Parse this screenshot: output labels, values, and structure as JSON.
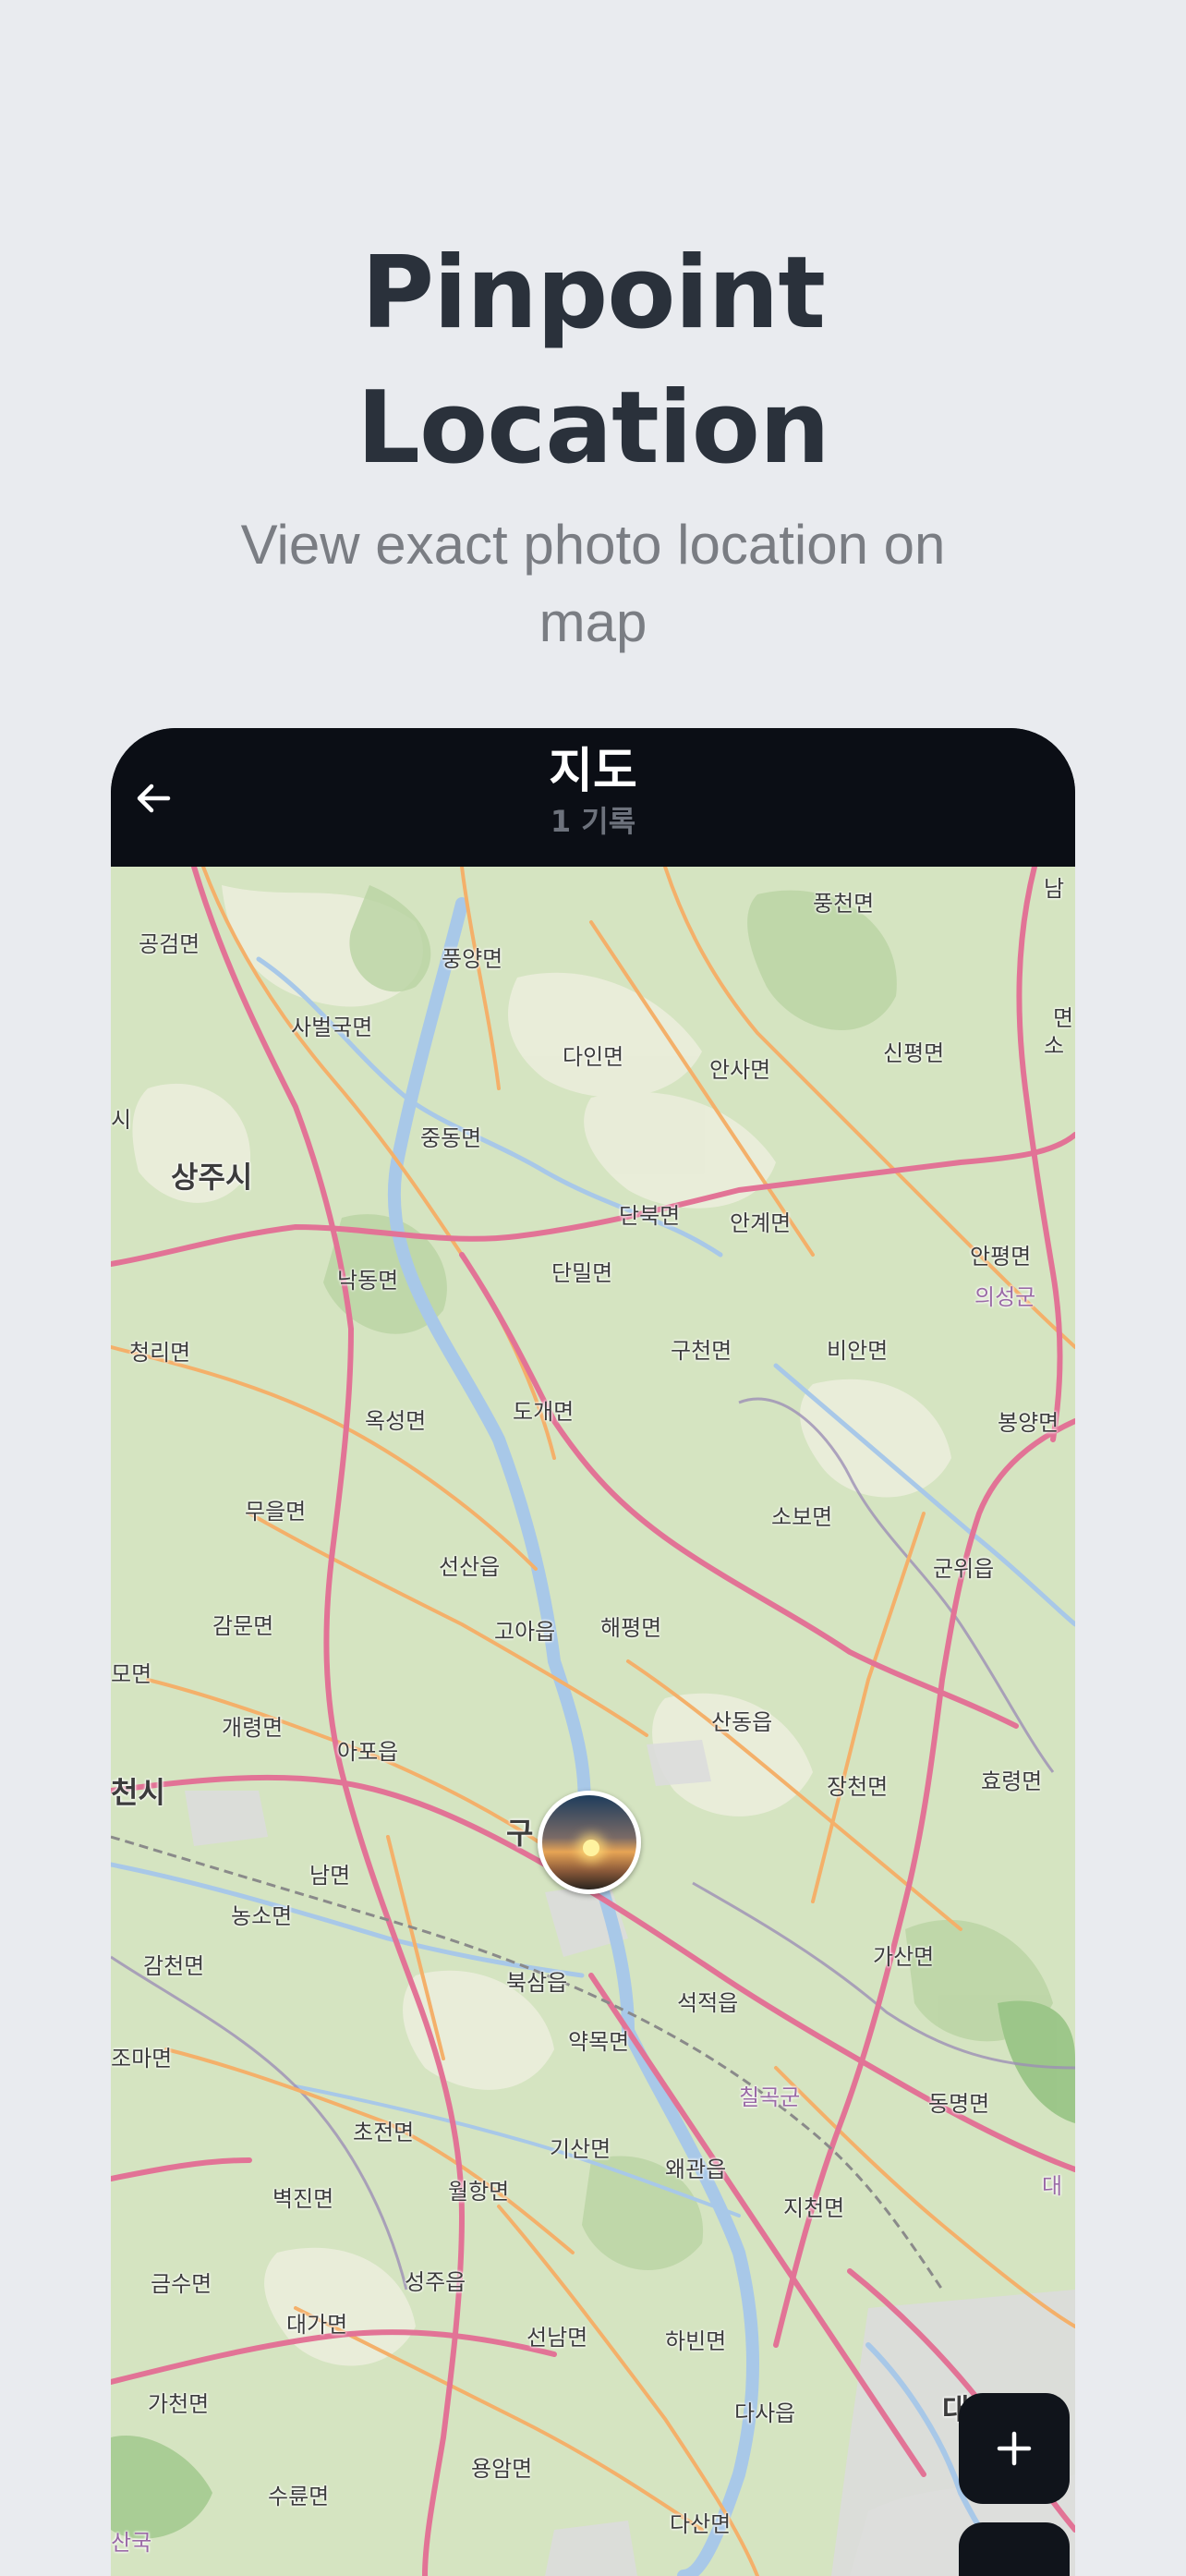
{
  "headline": [
    "Pinpoint",
    "Location"
  ],
  "subtitle": "View exact photo location on map",
  "app": {
    "title": "지도",
    "subtitle": "1 기록"
  },
  "map": {
    "places": [
      {
        "name": "공검면",
        "kind": "normal"
      },
      {
        "name": "풍양면",
        "kind": "normal"
      },
      {
        "name": "풍천면",
        "kind": "normal"
      },
      {
        "name": "사벌국면",
        "kind": "normal"
      },
      {
        "name": "다인면",
        "kind": "normal"
      },
      {
        "name": "안사면",
        "kind": "normal"
      },
      {
        "name": "신평면",
        "kind": "normal"
      },
      {
        "name": "중동면",
        "kind": "normal"
      },
      {
        "name": "상주시",
        "kind": "big"
      },
      {
        "name": "단북면",
        "kind": "normal"
      },
      {
        "name": "안계면",
        "kind": "normal"
      },
      {
        "name": "안평면",
        "kind": "normal"
      },
      {
        "name": "의성군",
        "kind": "purple"
      },
      {
        "name": "낙동면",
        "kind": "normal"
      },
      {
        "name": "단밀면",
        "kind": "normal"
      },
      {
        "name": "청리면",
        "kind": "normal"
      },
      {
        "name": "구천면",
        "kind": "normal"
      },
      {
        "name": "비안면",
        "kind": "normal"
      },
      {
        "name": "옥성면",
        "kind": "normal"
      },
      {
        "name": "도개면",
        "kind": "normal"
      },
      {
        "name": "봉양면",
        "kind": "normal"
      },
      {
        "name": "무을면",
        "kind": "normal"
      },
      {
        "name": "소보면",
        "kind": "normal"
      },
      {
        "name": "선산읍",
        "kind": "normal"
      },
      {
        "name": "군위읍",
        "kind": "normal"
      },
      {
        "name": "감문면",
        "kind": "normal"
      },
      {
        "name": "고아읍",
        "kind": "normal"
      },
      {
        "name": "해평면",
        "kind": "normal"
      },
      {
        "name": "모면",
        "kind": "normal"
      },
      {
        "name": "개령면",
        "kind": "normal"
      },
      {
        "name": "산동읍",
        "kind": "normal"
      },
      {
        "name": "아포읍",
        "kind": "normal"
      },
      {
        "name": "천시",
        "kind": "big"
      },
      {
        "name": "장천면",
        "kind": "normal"
      },
      {
        "name": "효령면",
        "kind": "normal"
      },
      {
        "name": "구",
        "kind": "big"
      },
      {
        "name": "남면",
        "kind": "normal"
      },
      {
        "name": "농소면",
        "kind": "normal"
      },
      {
        "name": "감천면",
        "kind": "normal"
      },
      {
        "name": "가산면",
        "kind": "normal"
      },
      {
        "name": "북삼읍",
        "kind": "normal"
      },
      {
        "name": "석적읍",
        "kind": "normal"
      },
      {
        "name": "조마면",
        "kind": "normal"
      },
      {
        "name": "약목면",
        "kind": "normal"
      },
      {
        "name": "칠곡군",
        "kind": "purple"
      },
      {
        "name": "동명면",
        "kind": "normal"
      },
      {
        "name": "초전면",
        "kind": "normal"
      },
      {
        "name": "기산면",
        "kind": "normal"
      },
      {
        "name": "벽진면",
        "kind": "normal"
      },
      {
        "name": "월항면",
        "kind": "normal"
      },
      {
        "name": "왜관읍",
        "kind": "normal"
      },
      {
        "name": "지천면",
        "kind": "normal"
      },
      {
        "name": "대",
        "kind": "purple"
      },
      {
        "name": "금수면",
        "kind": "normal"
      },
      {
        "name": "성주읍",
        "kind": "normal"
      },
      {
        "name": "대가면",
        "kind": "normal"
      },
      {
        "name": "선남면",
        "kind": "normal"
      },
      {
        "name": "하빈면",
        "kind": "normal"
      },
      {
        "name": "가천면",
        "kind": "normal"
      },
      {
        "name": "다사읍",
        "kind": "normal"
      },
      {
        "name": "대",
        "kind": "big"
      },
      {
        "name": "용암면",
        "kind": "normal"
      },
      {
        "name": "수륜면",
        "kind": "normal"
      },
      {
        "name": "다산면",
        "kind": "normal"
      },
      {
        "name": "산국",
        "kind": "purple"
      },
      {
        "name": "남",
        "kind": "normal"
      },
      {
        "name": "면",
        "kind": "normal"
      },
      {
        "name": "소",
        "kind": "normal"
      },
      {
        "name": "시",
        "kind": "normal"
      }
    ]
  },
  "icons": {
    "back": "arrow-left-icon",
    "zoom_in": "plus-icon"
  },
  "colors": {
    "background": "#e9ebef",
    "appbar": "#0b0e15",
    "headline": "#2a313b",
    "subtitle": "#7a7d83"
  }
}
